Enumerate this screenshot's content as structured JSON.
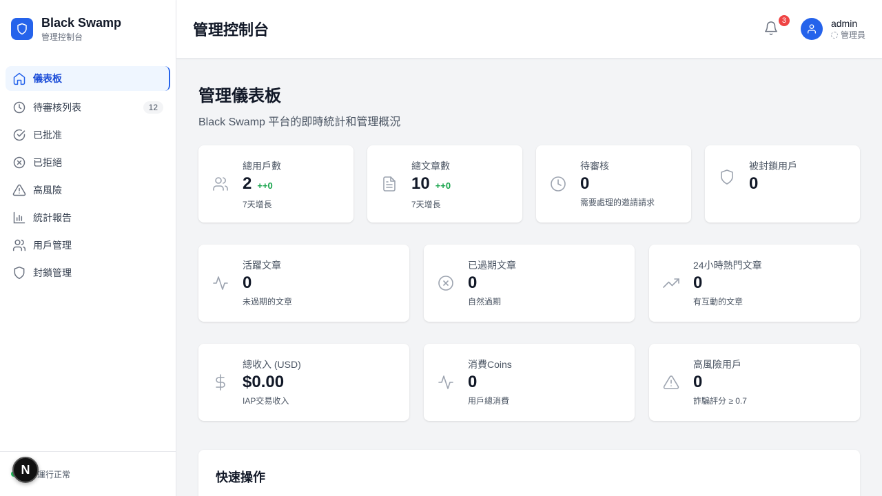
{
  "brand": {
    "name": "Black Swamp",
    "subtitle": "管理控制台"
  },
  "sidebar": {
    "items": [
      {
        "label": "儀表板",
        "icon": "home-icon",
        "active": true
      },
      {
        "label": "待審核列表",
        "icon": "clock-icon",
        "badge": "12"
      },
      {
        "label": "已批准",
        "icon": "check-circle-icon"
      },
      {
        "label": "已拒絕",
        "icon": "x-circle-icon"
      },
      {
        "label": "高風險",
        "icon": "alert-triangle-icon"
      },
      {
        "label": "統計報告",
        "icon": "bar-chart-icon"
      },
      {
        "label": "用戶管理",
        "icon": "users-icon"
      },
      {
        "label": "封鎖管理",
        "icon": "shield-icon"
      }
    ],
    "footer_status": "運行正常",
    "dev_badge": "N"
  },
  "header": {
    "title": "管理控制台",
    "notification_count": "3",
    "user_name": "admin",
    "user_role": "管理員"
  },
  "main": {
    "title": "管理儀表板",
    "subtitle": "Black Swamp 平台的即時統計和管理概況",
    "row1": [
      {
        "label": "總用戶數",
        "value": "2",
        "delta": "++0",
        "note": "7天增長",
        "icon": "users-icon"
      },
      {
        "label": "總文章數",
        "value": "10",
        "delta": "++0",
        "note": "7天增長",
        "icon": "file-text-icon"
      },
      {
        "label": "待審核",
        "value": "0",
        "delta": "",
        "note": "需要處理的邀請請求",
        "icon": "clock-icon"
      },
      {
        "label": "被封鎖用戶",
        "value": "0",
        "delta": "",
        "note": "",
        "icon": "shield-icon"
      }
    ],
    "row2": [
      {
        "label": "活躍文章",
        "value": "0",
        "note": "未過期的文章",
        "icon": "activity-icon"
      },
      {
        "label": "已過期文章",
        "value": "0",
        "note": "自然過期",
        "icon": "x-circle-icon"
      },
      {
        "label": "24小時熱門文章",
        "value": "0",
        "note": "有互動的文章",
        "icon": "trending-up-icon"
      }
    ],
    "row3": [
      {
        "label": "總收入 (USD)",
        "value": "$0.00",
        "note": "IAP交易收入",
        "icon": "dollar-icon"
      },
      {
        "label": "消費Coins",
        "value": "0",
        "note": "用戶總消費",
        "icon": "activity-icon"
      },
      {
        "label": "高風險用戶",
        "value": "0",
        "note": "詐騙評分 ≥ 0.7",
        "icon": "alert-triangle-icon"
      }
    ],
    "quick_actions_title": "快速操作"
  },
  "colors": {
    "accent": "#2563eb",
    "success": "#16a34a",
    "danger": "#ef4444"
  }
}
